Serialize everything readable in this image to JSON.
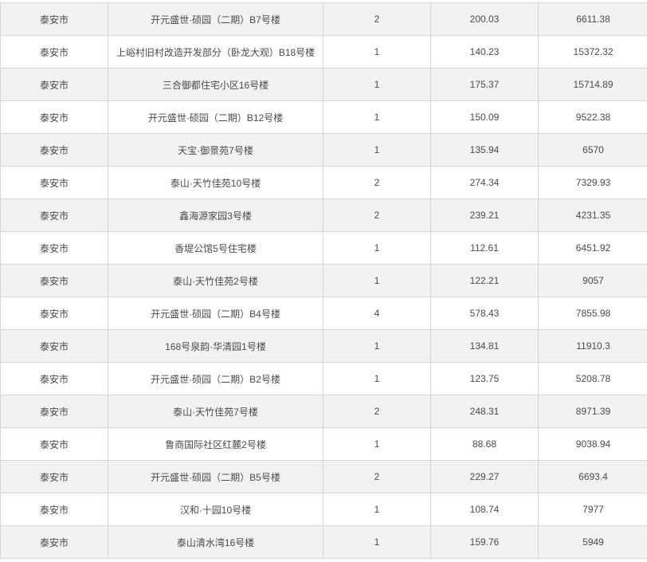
{
  "table": {
    "rows": [
      {
        "city": "泰安市",
        "project": "开元盛世·硕园（二期）B7号楼",
        "units": "2",
        "area": "200.03",
        "price": "6611.38"
      },
      {
        "city": "泰安市",
        "project": "上峪村旧村改造开发部分（卧龙大观）B18号楼",
        "units": "1",
        "area": "140.23",
        "price": "15372.32"
      },
      {
        "city": "泰安市",
        "project": "三合御都住宅小区16号楼",
        "units": "1",
        "area": "175.37",
        "price": "15714.89"
      },
      {
        "city": "泰安市",
        "project": "开元盛世·硕园（二期）B12号楼",
        "units": "1",
        "area": "150.09",
        "price": "9522.38"
      },
      {
        "city": "泰安市",
        "project": "天宝·御景苑7号楼",
        "units": "1",
        "area": "135.94",
        "price": "6570"
      },
      {
        "city": "泰安市",
        "project": "泰山·天竹佳苑10号楼",
        "units": "2",
        "area": "274.34",
        "price": "7329.93"
      },
      {
        "city": "泰安市",
        "project": "鑫海源家园3号楼",
        "units": "2",
        "area": "239.21",
        "price": "4231.35"
      },
      {
        "city": "泰安市",
        "project": "香堤公馆5号住宅楼",
        "units": "1",
        "area": "112.61",
        "price": "6451.92"
      },
      {
        "city": "泰安市",
        "project": "泰山·天竹佳苑2号楼",
        "units": "1",
        "area": "122.21",
        "price": "9057"
      },
      {
        "city": "泰安市",
        "project": "开元盛世·硕园（二期）B4号楼",
        "units": "4",
        "area": "578.43",
        "price": "7855.98"
      },
      {
        "city": "泰安市",
        "project": "168号泉韵·华清园1号楼",
        "units": "1",
        "area": "134.81",
        "price": "11910.3"
      },
      {
        "city": "泰安市",
        "project": "开元盛世·硕园（二期）B2号楼",
        "units": "1",
        "area": "123.75",
        "price": "5208.78"
      },
      {
        "city": "泰安市",
        "project": "泰山·天竹佳苑7号楼",
        "units": "2",
        "area": "248.31",
        "price": "8971.39"
      },
      {
        "city": "泰安市",
        "project": "鲁商国际社区红麓2号楼",
        "units": "1",
        "area": "88.68",
        "price": "9038.94"
      },
      {
        "city": "泰安市",
        "project": "开元盛世·硕园（二期）B5号楼",
        "units": "2",
        "area": "229.27",
        "price": "6693.4"
      },
      {
        "city": "泰安市",
        "project": "汉和·十园10号楼",
        "units": "1",
        "area": "108.74",
        "price": "7977"
      },
      {
        "city": "泰安市",
        "project": "泰山清水湾16号楼",
        "units": "1",
        "area": "159.76",
        "price": "5949"
      }
    ]
  }
}
